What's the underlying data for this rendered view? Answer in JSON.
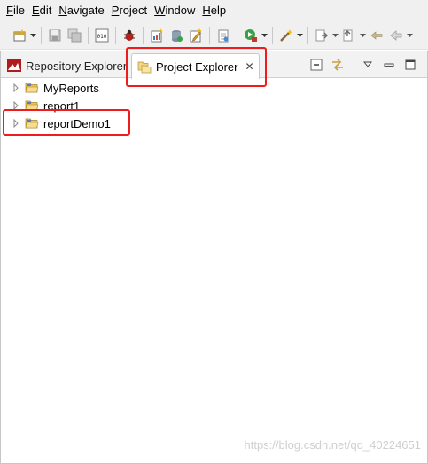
{
  "menubar": {
    "items": [
      {
        "underline": "F",
        "rest": "ile"
      },
      {
        "underline": "E",
        "rest": "dit"
      },
      {
        "underline": "N",
        "rest": "avigate"
      },
      {
        "underline": "P",
        "rest": "roject"
      },
      {
        "underline": "W",
        "rest": "indow"
      },
      {
        "underline": "H",
        "rest": "elp"
      }
    ]
  },
  "toolbar": {
    "icons": [
      "new-wizard-icon",
      "save-icon",
      "save-all-icon",
      "binary-icon",
      "debug-icon",
      "new-report-icon",
      "new-data-icon",
      "edit-icon",
      "page-icon",
      "run-icon",
      "wand-icon",
      "next-annotation-icon",
      "prev-annotation-icon",
      "back-icon",
      "back-arrow-icon"
    ]
  },
  "views": {
    "repository_tab": "Repository Explorer",
    "project_tab": "Project Explorer",
    "close_glyph": "✕"
  },
  "tree": {
    "items": [
      {
        "label": "MyReports"
      },
      {
        "label": "report1"
      },
      {
        "label": "reportDemo1"
      }
    ]
  },
  "watermark": "https://blog.csdn.net/qq_40224651",
  "colors": {
    "highlight": "#ee1c1c",
    "folder": "#e8c25a"
  }
}
